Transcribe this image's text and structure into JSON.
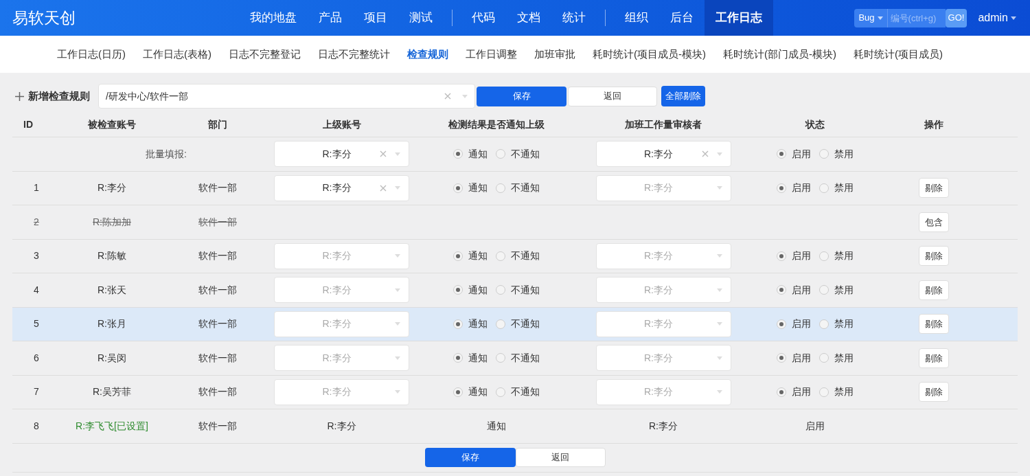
{
  "logo": "易软天创",
  "nav_groups": [
    [
      {
        "label": "我的地盘",
        "selected": false
      },
      {
        "label": "产品",
        "selected": false
      },
      {
        "label": "项目",
        "selected": false
      },
      {
        "label": "测试",
        "selected": false
      }
    ],
    [
      {
        "label": "代码",
        "selected": false
      },
      {
        "label": "文档",
        "selected": false
      },
      {
        "label": "统计",
        "selected": false
      }
    ],
    [
      {
        "label": "组织",
        "selected": false
      },
      {
        "label": "后台",
        "selected": false
      },
      {
        "label": "工作日志",
        "selected": true
      }
    ]
  ],
  "search": {
    "type": "Bug",
    "placeholder": "编号(ctrl+g)",
    "go": "GO!"
  },
  "user": "admin",
  "subnav": [
    {
      "label": "工作日志(日历)",
      "selected": false
    },
    {
      "label": "工作日志(表格)",
      "selected": false
    },
    {
      "label": "日志不完整登记",
      "selected": false
    },
    {
      "label": "日志不完整统计",
      "selected": false
    },
    {
      "label": "检查规则",
      "selected": true
    },
    {
      "label": "工作日调整",
      "selected": false
    },
    {
      "label": "加班审批",
      "selected": false
    },
    {
      "label": "耗时统计(项目成员-模块)",
      "selected": false
    },
    {
      "label": "耗时统计(部门成员-模块)",
      "selected": false
    },
    {
      "label": "耗时统计(项目成员)",
      "selected": false
    }
  ],
  "toolbar": {
    "add": "新增检查规则",
    "department": "/研发中心/软件一部",
    "save": "保存",
    "back": "返回",
    "remove_all": "全部剔除"
  },
  "columns": [
    "ID",
    "被检查账号",
    "部门",
    "上级账号",
    "检测结果是否通知上级",
    "加班工作量审核者",
    "状态",
    "操作"
  ],
  "rows": [
    {
      "kind": "batch",
      "label": "批量填报:",
      "superior": {
        "value": "R:李分",
        "disabled": false
      },
      "notify": [
        {
          "label": "通知",
          "selected": true
        },
        {
          "label": "不通知",
          "selected": false
        }
      ],
      "reviewer": {
        "value": "R:李分",
        "disabled": false
      },
      "status": [
        {
          "label": "启用",
          "selected": true
        },
        {
          "label": "禁用",
          "selected": false
        }
      ],
      "highlighted": false
    },
    {
      "kind": "editable",
      "id": "1",
      "account": "R:李分",
      "dept": "软件一部",
      "superior": {
        "value": "R:李分",
        "disabled": false
      },
      "notify": [
        {
          "label": "通知",
          "selected": true
        },
        {
          "label": "不通知",
          "selected": false
        }
      ],
      "reviewer": {
        "value": "R:李分",
        "disabled": true
      },
      "status": [
        {
          "label": "启用",
          "selected": true
        },
        {
          "label": "禁用",
          "selected": false
        }
      ],
      "action": "剔除",
      "highlighted": false
    },
    {
      "kind": "removed",
      "id": "2",
      "account": "R:陈加加",
      "dept": "软件一部",
      "action": "包含",
      "highlighted": false
    },
    {
      "kind": "editable",
      "id": "3",
      "account": "R:陈敏",
      "dept": "软件一部",
      "superior": {
        "value": "R:李分",
        "disabled": true
      },
      "notify": [
        {
          "label": "通知",
          "selected": true
        },
        {
          "label": "不通知",
          "selected": false
        }
      ],
      "reviewer": {
        "value": "R:李分",
        "disabled": true
      },
      "status": [
        {
          "label": "启用",
          "selected": true
        },
        {
          "label": "禁用",
          "selected": false
        }
      ],
      "action": "剔除",
      "highlighted": false
    },
    {
      "kind": "editable",
      "id": "4",
      "account": "R:张天",
      "dept": "软件一部",
      "superior": {
        "value": "R:李分",
        "disabled": true
      },
      "notify": [
        {
          "label": "通知",
          "selected": true
        },
        {
          "label": "不通知",
          "selected": false
        }
      ],
      "reviewer": {
        "value": "R:李分",
        "disabled": true
      },
      "status": [
        {
          "label": "启用",
          "selected": true
        },
        {
          "label": "禁用",
          "selected": false
        }
      ],
      "action": "剔除",
      "highlighted": false
    },
    {
      "kind": "editable",
      "id": "5",
      "account": "R:张月",
      "dept": "软件一部",
      "superior": {
        "value": "R:李分",
        "disabled": true
      },
      "notify": [
        {
          "label": "通知",
          "selected": true
        },
        {
          "label": "不通知",
          "selected": false
        }
      ],
      "reviewer": {
        "value": "R:李分",
        "disabled": true
      },
      "status": [
        {
          "label": "启用",
          "selected": true
        },
        {
          "label": "禁用",
          "selected": false
        }
      ],
      "action": "剔除",
      "highlighted": true
    },
    {
      "kind": "editable",
      "id": "6",
      "account": "R:吴闵",
      "dept": "软件一部",
      "superior": {
        "value": "R:李分",
        "disabled": true
      },
      "notify": [
        {
          "label": "通知",
          "selected": true
        },
        {
          "label": "不通知",
          "selected": false
        }
      ],
      "reviewer": {
        "value": "R:李分",
        "disabled": true
      },
      "status": [
        {
          "label": "启用",
          "selected": true
        },
        {
          "label": "禁用",
          "selected": false
        }
      ],
      "action": "剔除",
      "highlighted": false
    },
    {
      "kind": "editable",
      "id": "7",
      "account": "R:吴芳菲",
      "dept": "软件一部",
      "superior": {
        "value": "R:李分",
        "disabled": true
      },
      "notify": [
        {
          "label": "通知",
          "selected": true
        },
        {
          "label": "不通知",
          "selected": false
        }
      ],
      "reviewer": {
        "value": "R:李分",
        "disabled": true
      },
      "status": [
        {
          "label": "启用",
          "selected": true
        },
        {
          "label": "禁用",
          "selected": false
        }
      ],
      "action": "剔除",
      "highlighted": false
    },
    {
      "kind": "set",
      "id": "8",
      "account": "R:李飞飞[已设置]",
      "dept": "软件一部",
      "superior": "R:李分",
      "notify": "通知",
      "reviewer": "R:李分",
      "status": "启用",
      "highlighted": false
    }
  ],
  "footer": {
    "save": "保存",
    "back": "返回"
  }
}
